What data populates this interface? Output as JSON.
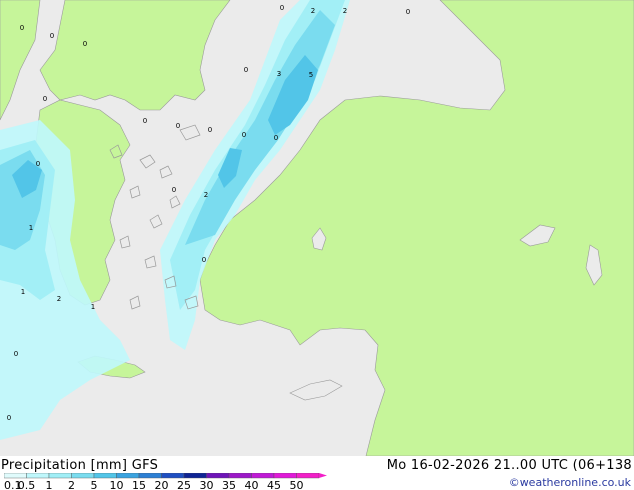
{
  "title": "Precipitation [mm]  GFS",
  "datetime": "Mo 16-02-2026 21..00 UTC (06+138",
  "credit": "©weatheronline.co.uk",
  "colors": {
    "sea": "#ebebeb",
    "land": "#c6f59a",
    "p01": "#bff7fb",
    "p05": "#a0eef6",
    "p1": "#7adcef",
    "p2": "#52c5e8",
    "p5": "#3aa3e0"
  },
  "legend": {
    "labels": [
      "0.1",
      "0.5",
      "1",
      "2",
      "5",
      "10",
      "15",
      "20",
      "25",
      "30",
      "35",
      "40",
      "45",
      "50"
    ],
    "colors": [
      "#e0fbfc",
      "#bff7fb",
      "#a0eef6",
      "#7adcef",
      "#52c5e8",
      "#3aa3e0",
      "#2c7fd4",
      "#1f4fc2",
      "#0f2494",
      "#6e14b8",
      "#9c18c8",
      "#c01ad6",
      "#e01ad8",
      "#f21fc8"
    ]
  },
  "station_values": [
    {
      "label": "2"
    },
    {
      "label": "2"
    },
    {
      "label": "0"
    },
    {
      "label": "0"
    },
    {
      "label": "0"
    },
    {
      "label": "3"
    },
    {
      "label": "5"
    },
    {
      "label": "0"
    },
    {
      "label": "0"
    },
    {
      "label": "0"
    },
    {
      "label": "0"
    },
    {
      "label": "0"
    },
    {
      "label": "0"
    },
    {
      "label": "0"
    },
    {
      "label": "0"
    },
    {
      "label": "0"
    },
    {
      "label": "0"
    },
    {
      "label": "2"
    },
    {
      "label": "1"
    },
    {
      "label": "2"
    },
    {
      "label": "1"
    },
    {
      "label": "0"
    },
    {
      "label": "1"
    },
    {
      "label": "0"
    },
    {
      "label": "0"
    },
    {
      "label": "0"
    }
  ]
}
